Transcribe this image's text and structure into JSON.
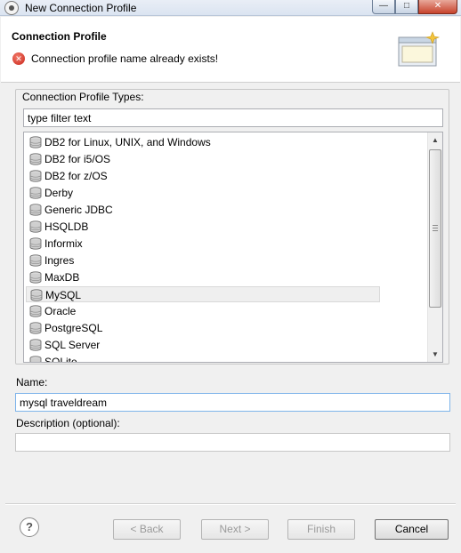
{
  "window": {
    "title": "New Connection Profile",
    "min_glyph": "—",
    "max_glyph": "□",
    "close_glyph": "✕"
  },
  "header": {
    "heading": "Connection Profile",
    "error_icon_glyph": "✕",
    "error_message": "Connection profile name already exists!"
  },
  "profile_types": {
    "group_label": "Connection Profile Types:",
    "filter_value": "type filter text",
    "selected": "MySQL",
    "items": [
      {
        "label": "DB2 for Linux, UNIX, and Windows"
      },
      {
        "label": "DB2 for i5/OS"
      },
      {
        "label": "DB2 for z/OS"
      },
      {
        "label": "Derby"
      },
      {
        "label": "Generic JDBC"
      },
      {
        "label": "HSQLDB"
      },
      {
        "label": "Informix"
      },
      {
        "label": "Ingres"
      },
      {
        "label": "MaxDB"
      },
      {
        "label": "MySQL"
      },
      {
        "label": "Oracle"
      },
      {
        "label": "PostgreSQL"
      },
      {
        "label": "SQL Server"
      },
      {
        "label": "SQLite"
      }
    ],
    "scroll_up_glyph": "▲",
    "scroll_down_glyph": "▼"
  },
  "name_field": {
    "label": "Name:",
    "value": "mysql traveldream"
  },
  "description_field": {
    "label": "Description (optional):",
    "value": ""
  },
  "footer": {
    "help_glyph": "?",
    "back_label": "< Back",
    "next_label": "Next >",
    "finish_label": "Finish",
    "cancel_label": "Cancel"
  },
  "colors": {
    "error_red": "#c9261b",
    "focus_border": "#7eb4ea"
  }
}
